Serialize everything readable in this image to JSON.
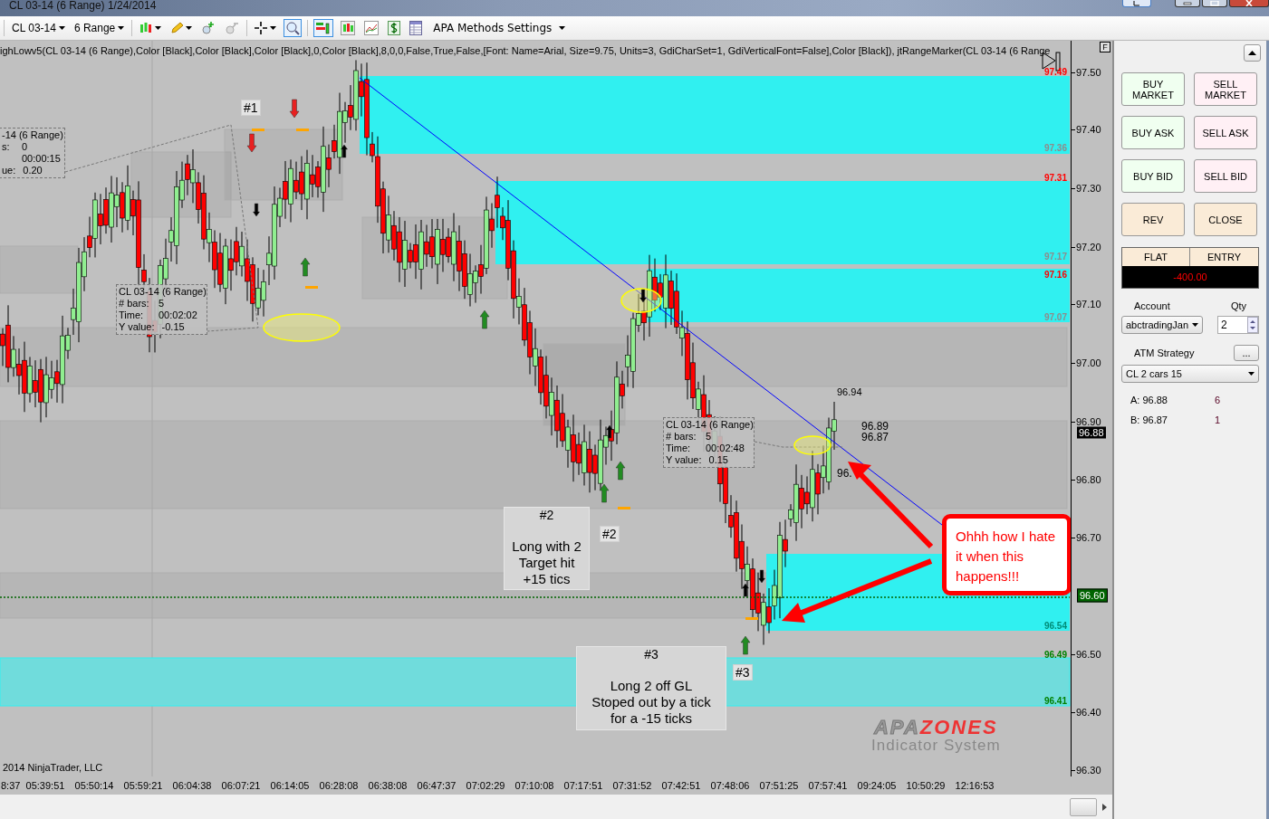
{
  "window": {
    "title": "CL 03-14 (6 Range)  1/24/2014"
  },
  "toolbar": {
    "instrument": "CL 03-14",
    "period": "6 Range",
    "menu": "APA Methods Settings"
  },
  "chart": {
    "indicator_text": "ighLowv5(CL 03-14 (6 Range),Color [Black],Color [Black],Color [Black],0,Color [Black],8,0,0,False,True,False,[Font: Name=Arial, Size=9.75, Units=3, GdiCharSet=1, GdiVerticalFont=False],Color [Black]), jtRangeMarker(CL 03-14 (6 Range",
    "panel_button": "F",
    "zone_labels": [
      {
        "text": "97.49",
        "color": "#ff0000"
      },
      {
        "text": "97.36",
        "color": "#8c8c8c"
      },
      {
        "text": "97.31",
        "color": "#ff0000"
      },
      {
        "text": "97.17",
        "color": "#8c8c8c"
      },
      {
        "text": "97.16",
        "color": "#ff0000"
      },
      {
        "text": "97.07",
        "color": "#8c8c8c"
      },
      {
        "text": "96.54",
        "color": "#008c78"
      },
      {
        "text": "96.49",
        "color": "#008000"
      },
      {
        "text": "96.41",
        "color": "#008000"
      }
    ],
    "trade_tags": [
      "#1",
      "#2",
      "#3"
    ],
    "notes": [
      {
        "tag": "#2",
        "text": "Long with 2\nTarget hit\n+15 tics"
      },
      {
        "tag": "#3",
        "text": "Long 2 off GL\nStoped out by a tick\nfor a -15 ticks"
      }
    ],
    "measurements": [
      {
        "title": "-14 (6 Range)",
        "rows": [
          {
            "label": "s:",
            "value": "0"
          },
          {
            "value": "00:00:15"
          },
          {
            "label": "ue:",
            "value": "0.20"
          }
        ]
      },
      {
        "title": "CL 03-14 (6 Range)",
        "rows": [
          {
            "label": "# bars:",
            "value": "5"
          },
          {
            "label": "Time:",
            "value": "00:02:02"
          },
          {
            "label": "Y value:",
            "value": "-0.15"
          }
        ]
      },
      {
        "title": "CL 03-14 (6 Range)",
        "rows": [
          {
            "label": "# bars:",
            "value": "5"
          },
          {
            "label": "Time:",
            "value": "00:02:48"
          },
          {
            "label": "Y value:",
            "value": "0.15"
          }
        ]
      }
    ],
    "price_labels": [
      "96.94",
      "96.89",
      "96.87",
      "96."
    ],
    "callout": "Ohhh how I hate\nit when this\nhappens!!!",
    "copyright": "2014 NinjaTrader, LLC",
    "logo": {
      "prefix": "APA",
      "name": "ZONES",
      "tagline": "Indicator System"
    }
  },
  "price_axis": {
    "ticks": [
      "97.50",
      "97.40",
      "97.30",
      "97.20",
      "97.10",
      "97.00",
      "96.90",
      "96.80",
      "96.70",
      "96.50",
      "96.40",
      "96.30"
    ],
    "markers": [
      {
        "text": "96.88",
        "kind": "last"
      },
      {
        "text": "96.60",
        "kind": "line"
      }
    ]
  },
  "time_axis": [
    "8:37",
    "05:39:51",
    "05:50:14",
    "05:59:21",
    "06:04:38",
    "06:07:21",
    "06:14:05",
    "06:28:08",
    "06:38:08",
    "06:47:37",
    "07:02:29",
    "07:10:08",
    "07:17:51",
    "07:31:52",
    "07:42:51",
    "07:48:06",
    "07:51:25",
    "07:57:41",
    "09:24:05",
    "10:50:29",
    "12:16:53"
  ],
  "order_panel": {
    "buttons": [
      {
        "label": "BUY\nMARKET",
        "kind": "buy"
      },
      {
        "label": "SELL\nMARKET",
        "kind": "sell"
      },
      {
        "label": "BUY ASK",
        "kind": "buy"
      },
      {
        "label": "SELL ASK",
        "kind": "sell"
      },
      {
        "label": "BUY BID",
        "kind": "buy"
      },
      {
        "label": "SELL BID",
        "kind": "sell"
      },
      {
        "label": "REV",
        "kind": "action"
      },
      {
        "label": "CLOSE",
        "kind": "action"
      }
    ],
    "position": {
      "status": "FLAT",
      "entry": "ENTRY",
      "pnl": "-400.00"
    },
    "account": {
      "label": "Account",
      "value": "abctradingJan"
    },
    "qty": {
      "label": "Qty",
      "value": "2"
    },
    "atm": {
      "label": "ATM Strategy",
      "button": "...",
      "value": "CL 2 cars 15"
    },
    "quotes": [
      {
        "label": "A: 96.88",
        "size": "6"
      },
      {
        "label": "B: 96.87",
        "size": "1"
      }
    ]
  }
}
